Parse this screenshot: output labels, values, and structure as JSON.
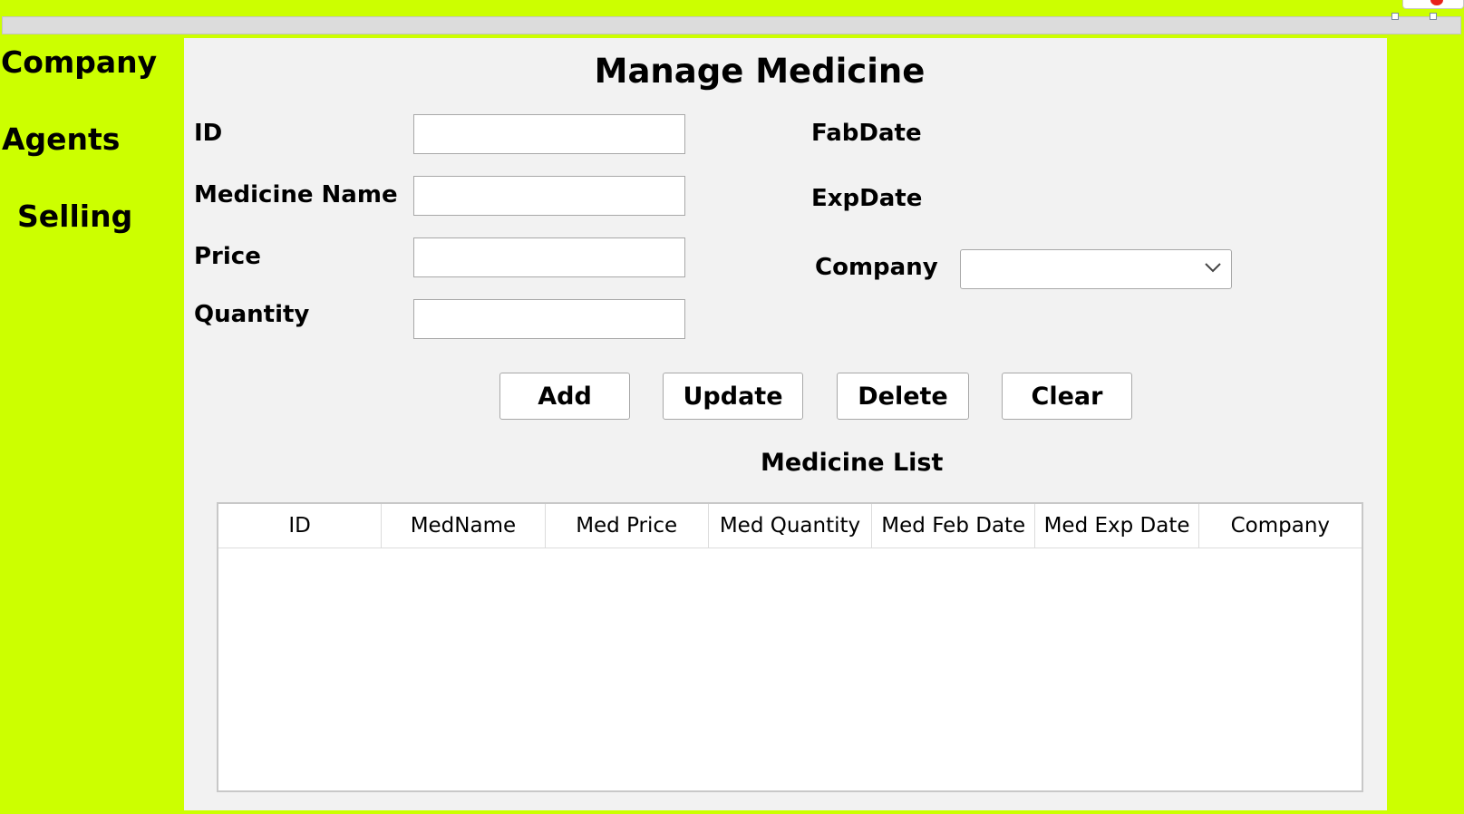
{
  "nav": {
    "items": [
      {
        "label": "Company"
      },
      {
        "label": "Agents"
      },
      {
        "label": "Selling"
      }
    ]
  },
  "form": {
    "title": "Manage Medicine",
    "id_label": "ID",
    "id_value": "",
    "name_label": "Medicine Name",
    "name_value": "",
    "price_label": "Price",
    "price_value": "",
    "quantity_label": "Quantity",
    "quantity_value": "",
    "fabdate_label": "FabDate",
    "expdate_label": "ExpDate",
    "company_label": "Company",
    "company_value": ""
  },
  "buttons": {
    "add": "Add",
    "update": "Update",
    "delete": "Delete",
    "clear": "Clear"
  },
  "table": {
    "title": "Medicine List",
    "columns": [
      "ID",
      "MedName",
      "Med Price",
      "Med Quantity",
      "Med Feb Date",
      "Med Exp Date",
      "Company"
    ],
    "rows": []
  },
  "colors": {
    "background": "#ccff00",
    "panel": "#f2f2f2"
  },
  "icons": {
    "dropdown": "chevron-down-icon"
  }
}
